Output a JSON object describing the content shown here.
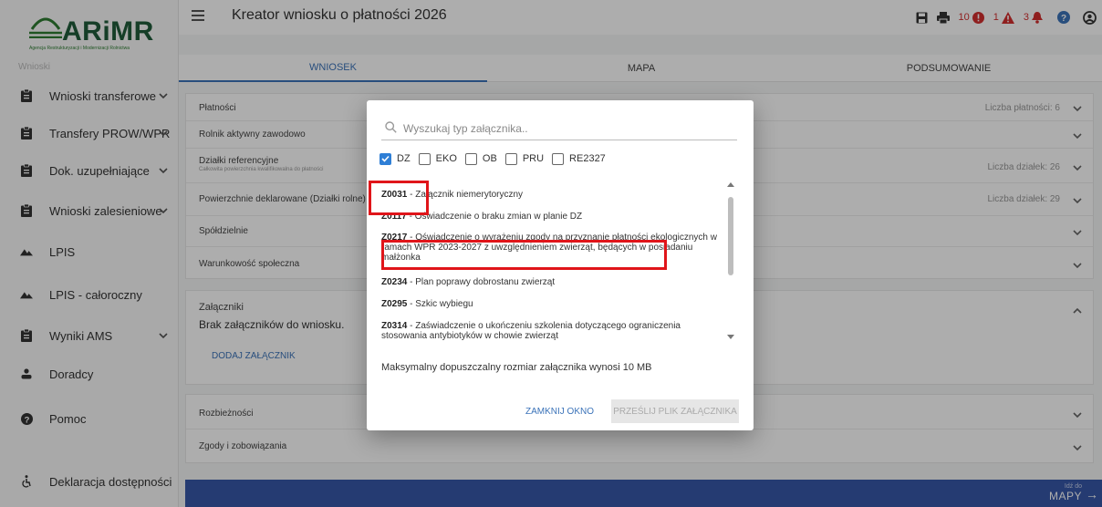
{
  "sidebar": {
    "logo_text": "ARiMR",
    "logo_sub": "Agencja Restrukturyzacji i Modernizacji Rolnictwa",
    "partial_label": "Wnioski",
    "items": [
      {
        "label": "Wnioski transferowe",
        "icon": "clipboard-icon",
        "has_chevron": true
      },
      {
        "label": "Transfery PROW/WPR",
        "icon": "clipboard-icon",
        "has_chevron": true
      },
      {
        "label": "Dok. uzupełniające",
        "icon": "clipboard-icon",
        "has_chevron": true
      },
      {
        "label": "Wnioski zalesieniowe",
        "icon": "clipboard-icon",
        "has_chevron": true
      },
      {
        "label": "LPIS",
        "icon": "mountain-icon",
        "has_chevron": false
      },
      {
        "label": "LPIS - całoroczny",
        "icon": "mountain-icon",
        "has_chevron": false
      },
      {
        "label": "Wyniki AMS",
        "icon": "clipboard-icon",
        "has_chevron": true
      },
      {
        "label": "Doradcy",
        "icon": "person-icon",
        "has_chevron": false
      },
      {
        "label": "Pomoc",
        "icon": "help-icon",
        "has_chevron": false
      },
      {
        "label": "Deklaracja dostępności",
        "icon": "accessibility-icon",
        "has_chevron": false
      }
    ]
  },
  "header": {
    "title": "Kreator wniosku o płatności 2026",
    "errors_count": "10",
    "warnings_count": "1",
    "notifications_count": "3"
  },
  "tabs": [
    {
      "label": "WNIOSEK",
      "active": true
    },
    {
      "label": "MAPA",
      "active": false
    },
    {
      "label": "PODSUMOWANIE",
      "active": false
    }
  ],
  "panels": {
    "platnosci": {
      "label": "Płatności",
      "right": "Liczba płatności: 6"
    },
    "rolnik": {
      "label": "Rolnik aktywny zawodowo"
    },
    "dzialki": {
      "label": "Działki referencyjne",
      "sub": "Całkowita powierzchnia kwalifikowalna do płatności",
      "right": "Liczba działek: 26"
    },
    "powierzchnie": {
      "label": "Powierzchnie deklarowane (Działki rolne)",
      "right": "Liczba działek: 29"
    },
    "spoldzielnie": {
      "label": "Spółdzielnie"
    },
    "warunkowosc": {
      "label": "Warunkowość społeczna"
    },
    "zalaczniki": {
      "label": "Załączniki",
      "empty": "Brak załączników do wniosku.",
      "add_button": "DODAJ ZAŁĄCZNIK"
    },
    "rozbieznosci": {
      "label": "Rozbieżności"
    },
    "zgody": {
      "label": "Zgody i zobowiązania"
    }
  },
  "bottom": {
    "goto_small": "Idź do",
    "goto_big": "MAPY"
  },
  "modal": {
    "search_placeholder": "Wyszukaj typ załącznika..",
    "filters": [
      {
        "label": "DZ",
        "checked": true
      },
      {
        "label": "EKO",
        "checked": false
      },
      {
        "label": "OB",
        "checked": false
      },
      {
        "label": "PRU",
        "checked": false
      },
      {
        "label": "RE2327",
        "checked": false
      }
    ],
    "items": [
      {
        "code": "Z0031",
        "desc": " - Załącznik niemerytoryczny"
      },
      {
        "code": "Z0117",
        "desc": " - Oświadczenie o braku zmian w planie DZ"
      },
      {
        "code": "Z0217",
        "desc": " - Oświadczenie o wyrażeniu zgody na przyznanie płatności ekologicznych w ramach WPR 2023-2027 z uwzględnieniem zwierząt, będących w posiadaniu małżonka"
      },
      {
        "code": "Z0234",
        "desc": " - Plan poprawy dobrostanu zwierząt"
      },
      {
        "code": "Z0295",
        "desc": " - Szkic wybiegu"
      },
      {
        "code": "Z0314",
        "desc": " - Zaświadczenie o ukończeniu szkolenia dotyczącego ograniczenia stosowania antybiotyków w chowie zwierząt"
      }
    ],
    "max_size_text": "Maksymalny dopuszczalny rozmiar załącznika wynosi 10 MB",
    "close_button": "ZAMKNIJ OKNO",
    "upload_button": "PRZEŚLIJ PLIK ZAŁĄCZNIKA"
  },
  "colors": {
    "accent": "#3b73b9",
    "brand": "#1f5c3a",
    "highlight": "#e0151a",
    "error": "#d32f2f",
    "bottom_bar": "#3757a8"
  }
}
